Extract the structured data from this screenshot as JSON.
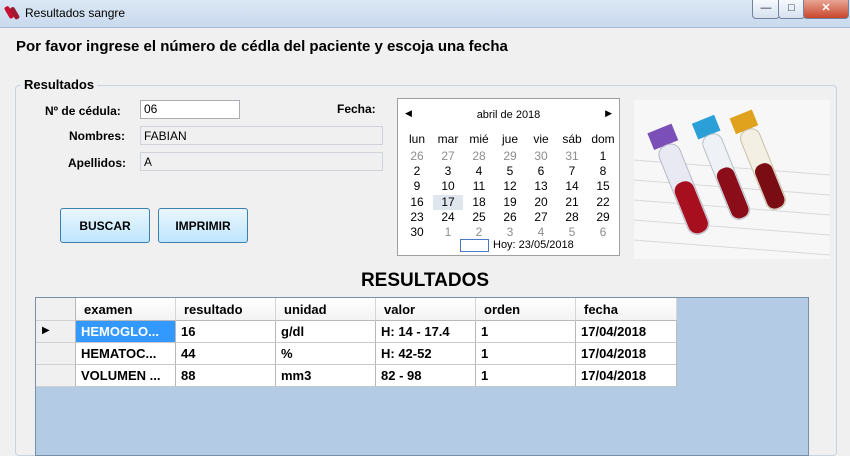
{
  "window": {
    "title": "Resultados sangre",
    "controls": {
      "minimize": "—",
      "maximize": "□",
      "close": "✕"
    }
  },
  "instruction": "Por favor ingrese el número de cédla del paciente y escoja una fecha",
  "group_title": "Resultados",
  "form": {
    "cedula_label": "Nº de cédula:",
    "cedula_value": "06",
    "nombres_label": "Nombres:",
    "nombres_value": "FABIAN",
    "apellidos_label": "Apellidos:",
    "apellidos_value": "A",
    "fecha_label": "Fecha:"
  },
  "buttons": {
    "buscar": "BUSCAR",
    "imprimir": "IMPRIMIR"
  },
  "calendar": {
    "prev": "◀",
    "next": "▶",
    "month_year": "abril de 2018",
    "weekdays": [
      "lun",
      "mar",
      "mié",
      "jue",
      "vie",
      "sáb",
      "dom"
    ],
    "weeks": [
      [
        "26",
        "27",
        "28",
        "29",
        "30",
        "31",
        "1"
      ],
      [
        "2",
        "3",
        "4",
        "5",
        "6",
        "7",
        "8"
      ],
      [
        "9",
        "10",
        "11",
        "12",
        "13",
        "14",
        "15"
      ],
      [
        "16",
        "17",
        "18",
        "19",
        "20",
        "21",
        "22"
      ],
      [
        "23",
        "24",
        "25",
        "26",
        "27",
        "28",
        "29"
      ],
      [
        "30",
        "1",
        "2",
        "3",
        "4",
        "5",
        "6"
      ]
    ],
    "selected": "17",
    "today_text": "Hoy: 23/05/2018"
  },
  "results_title": "RESULTADOS",
  "table": {
    "columns": [
      "examen",
      "resultado",
      "unidad",
      "valor",
      "orden",
      "fecha"
    ],
    "rows": [
      [
        "HEMOGLO...",
        "16",
        "g/dl",
        "H: 14 - 17.4",
        "1",
        "17/04/2018"
      ],
      [
        "HEMATOC...",
        "44",
        "%",
        "H: 42-52",
        "1",
        "17/04/2018"
      ],
      [
        "VOLUMEN ...",
        "88",
        "mm3",
        "82 - 98",
        "1",
        "17/04/2018"
      ]
    ],
    "current_row_marker": "▶"
  },
  "colors": {
    "accent": "#3399ff",
    "grid_background": "#b4cbe6"
  }
}
